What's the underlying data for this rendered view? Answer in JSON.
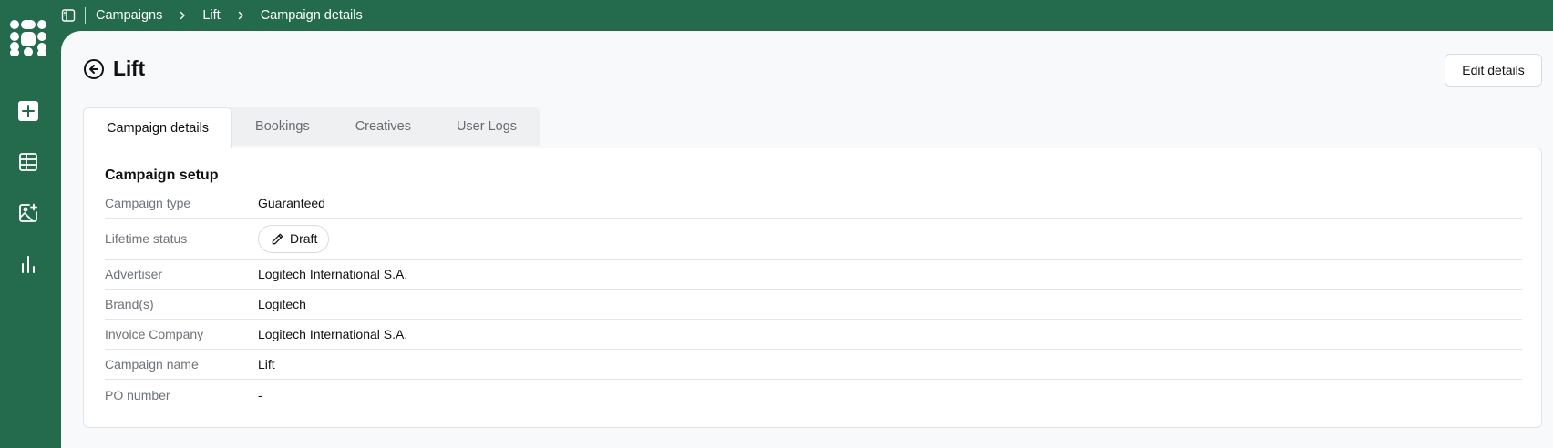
{
  "breadcrumb": [
    "Campaigns",
    "Lift",
    "Campaign details"
  ],
  "page": {
    "title": "Lift",
    "edit_button": "Edit details"
  },
  "tabs": [
    {
      "label": "Campaign details",
      "active": true
    },
    {
      "label": "Bookings",
      "active": false
    },
    {
      "label": "Creatives",
      "active": false
    },
    {
      "label": "User Logs",
      "active": false
    }
  ],
  "section": {
    "title": "Campaign setup",
    "rows": [
      {
        "label": "Campaign type",
        "value": "Guaranteed"
      },
      {
        "label": "Lifetime status",
        "value": "Draft",
        "icon": "pencil-icon"
      },
      {
        "label": "Advertiser",
        "value": "Logitech International S.A."
      },
      {
        "label": "Brand(s)",
        "value": "Logitech"
      },
      {
        "label": "Invoice Company",
        "value": "Logitech International S.A."
      },
      {
        "label": "Campaign name",
        "value": "Lift"
      },
      {
        "label": "PO number",
        "value": "-"
      }
    ]
  },
  "sidebar": {
    "icons": [
      "app-logo",
      "add-icon",
      "table-icon",
      "image-plus-icon",
      "bar-chart-icon"
    ]
  },
  "colors": {
    "brand_green": "#246b4d",
    "content_bg": "#f8f9fa",
    "card_bg": "#ffffff",
    "muted_text": "#6e7378"
  }
}
